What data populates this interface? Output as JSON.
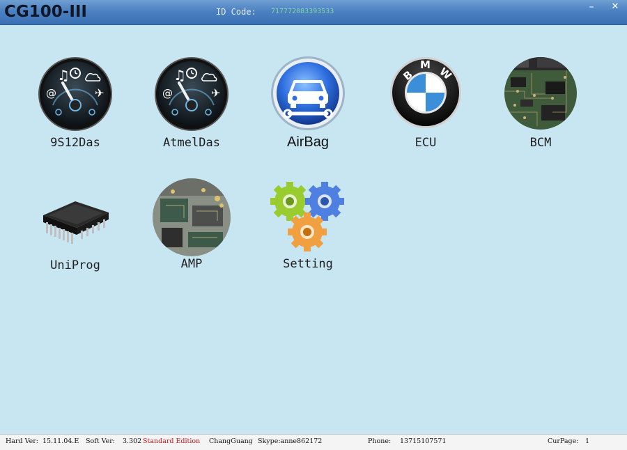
{
  "window": {
    "title": "CG100-III",
    "id_label": "ID Code:",
    "id_value": "717772083393533",
    "minimize_glyph": "–",
    "close_glyph": "✕"
  },
  "modules": [
    {
      "label": "9S12Das",
      "icon": "gauge-dashboard-icon"
    },
    {
      "label": "AtmelDas",
      "icon": "gauge-dashboard-icon"
    },
    {
      "label": "AirBag",
      "icon": "car-service-icon"
    },
    {
      "label": "ECU",
      "icon": "bmw-logo-icon"
    },
    {
      "label": "BCM",
      "icon": "circuit-board-icon"
    },
    {
      "label": "UniProg",
      "icon": "chip-icon"
    },
    {
      "label": "AMP",
      "icon": "circuit-board-icon"
    },
    {
      "label": "Setting",
      "icon": "gears-icon"
    }
  ],
  "bmw_letters": [
    "B",
    "M",
    "W"
  ],
  "status": {
    "hard_ver_label": "Hard Ver:",
    "hard_ver": "15.11.04.E",
    "soft_ver_label": "Soft Ver:",
    "soft_ver": "3.302",
    "edition": "Standard Edition",
    "company": "ChangGuang",
    "skype": "Skype:anne862172",
    "phone_label": "Phone:",
    "phone": "13715107571",
    "curpage_label": "CurPage:",
    "curpage": "1"
  },
  "colors": {
    "background": "#c8e6f1",
    "titlebar": "#4c81c2",
    "edition": "#c8141e"
  }
}
